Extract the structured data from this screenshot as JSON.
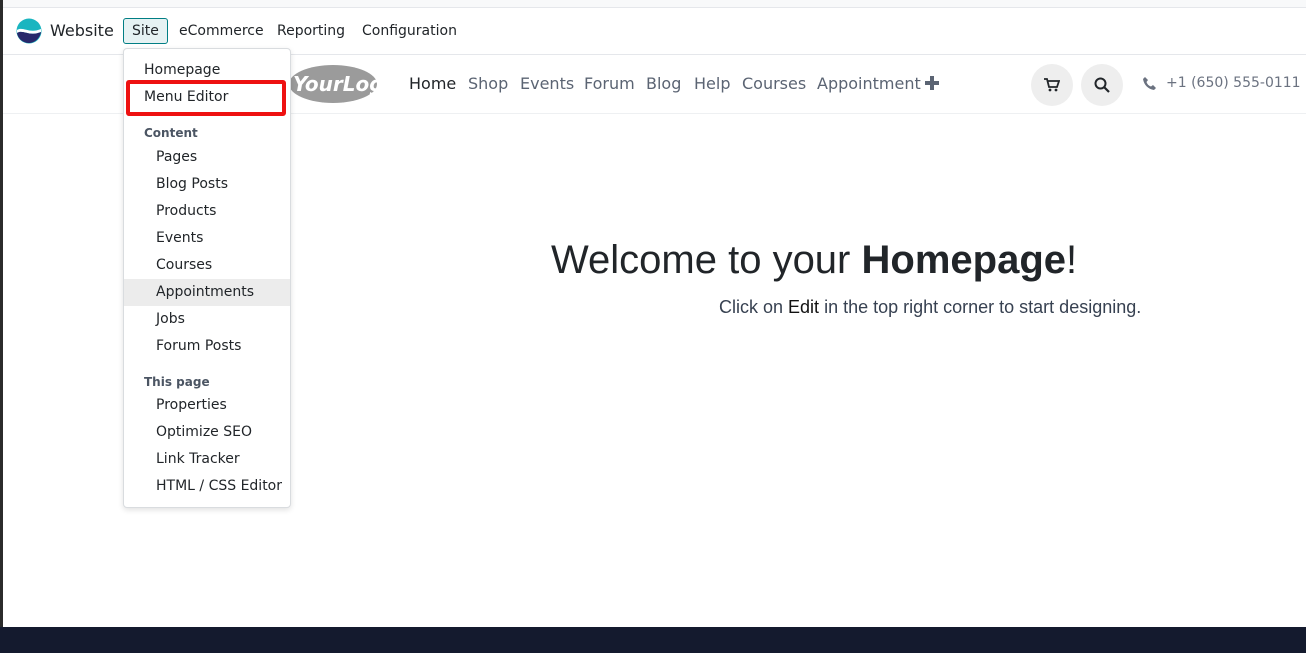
{
  "topbar": {
    "app_name": "Website",
    "menus": [
      "Site",
      "eCommerce",
      "Reporting",
      "Configuration"
    ]
  },
  "site_menu_dropdown": {
    "homepage": "Homepage",
    "menu_editor": "Menu Editor",
    "content_header": "Content",
    "content_items": [
      "Pages",
      "Blog Posts",
      "Products",
      "Events",
      "Courses",
      "Appointments",
      "Jobs",
      "Forum Posts"
    ],
    "this_page_header": "This page",
    "page_items": [
      "Properties",
      "Optimize SEO",
      "Link Tracker",
      "HTML / CSS Editor"
    ],
    "hovered_item": "Appointments"
  },
  "website_header": {
    "logo_text": "YourLogo",
    "nav": [
      "Home",
      "Shop",
      "Events",
      "Forum",
      "Blog",
      "Help",
      "Courses",
      "Appointment"
    ],
    "current_nav": "Home",
    "phone": "+1 (650) 555-0111"
  },
  "main": {
    "welcome_prefix": "Welcome to your ",
    "welcome_bold": "Homepage",
    "welcome_suffix": "!",
    "hint_prefix": "Click on ",
    "hint_bold": "Edit",
    "hint_suffix": " in the top right corner to start designing."
  },
  "colors": {
    "accent": "#017e84",
    "highlight": "#ee1111",
    "footer_band": "#141a2e"
  },
  "icons": [
    "odoo-website-logo-icon",
    "plus-icon",
    "cart-icon",
    "search-icon",
    "phone-icon"
  ]
}
